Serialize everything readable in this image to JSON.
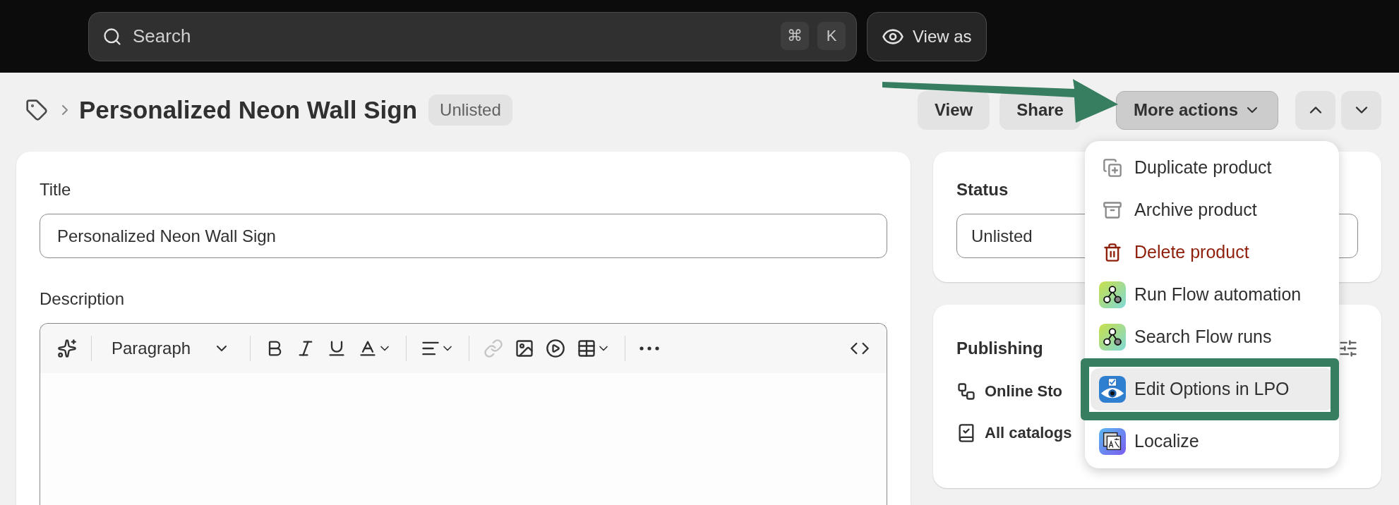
{
  "top_bar": {
    "search": {
      "placeholder": "Search",
      "shortcut": [
        "⌘",
        "K"
      ]
    },
    "view_as": "View as"
  },
  "header": {
    "title": "Personalized Neon Wall Sign",
    "badge": "Unlisted",
    "buttons": [
      "View",
      "Share"
    ],
    "more_actions": "More actions"
  },
  "menu": {
    "items": [
      {
        "label": "Duplicate product",
        "kind": "duplicate",
        "selected": false
      },
      {
        "label": "Archive product",
        "kind": "archive",
        "selected": false
      },
      {
        "label": "Delete product",
        "kind": "delete",
        "selected": false
      },
      {
        "label": "Run Flow automation",
        "kind": "flow",
        "selected": false
      },
      {
        "label": "Search Flow runs",
        "kind": "flow",
        "selected": false
      },
      {
        "label": "Edit Options in LPO",
        "kind": "lpo",
        "selected": true
      },
      {
        "label": "Localize",
        "kind": "localize",
        "selected": false
      }
    ]
  },
  "main_card": {
    "title_label": "Title",
    "title_value": "Personalized Neon Wall Sign",
    "description_label": "Description",
    "toolbar": {
      "block_style": "Paragraph",
      "link_disabled": true
    }
  },
  "status_card": {
    "label": "Status",
    "value": "Unlisted"
  },
  "publishing_card": {
    "label": "Publishing",
    "channels": [
      {
        "label": "Online Sto",
        "kind": "store"
      },
      {
        "label": "All catalogs",
        "kind": "catalog"
      }
    ]
  }
}
